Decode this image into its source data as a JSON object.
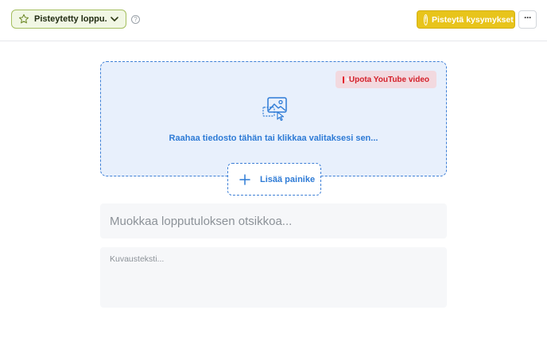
{
  "topbar": {
    "result_selector": {
      "label": "Pisteytetty loppu...",
      "icon": "star-icon"
    },
    "help_icon": "?",
    "score_button": {
      "label": "Pisteytä kysymykset",
      "icon": "!"
    },
    "more_button": {
      "label": "···"
    }
  },
  "media": {
    "youtube_button": "Upota YouTube video",
    "drop_text": "Raahaa tiedosto tähän tai klikkaa valitaksesi sen...",
    "add_button": "Lisää painike"
  },
  "form": {
    "title_placeholder": "Muokkaa lopputuloksen otsikkoa...",
    "description_placeholder": "Kuvausteksti..."
  },
  "colors": {
    "accent_blue": "#2e7bd6",
    "score_yellow": "#e8c41b",
    "youtube_red": "#e3252d",
    "selector_green": "#a4bf5f"
  }
}
